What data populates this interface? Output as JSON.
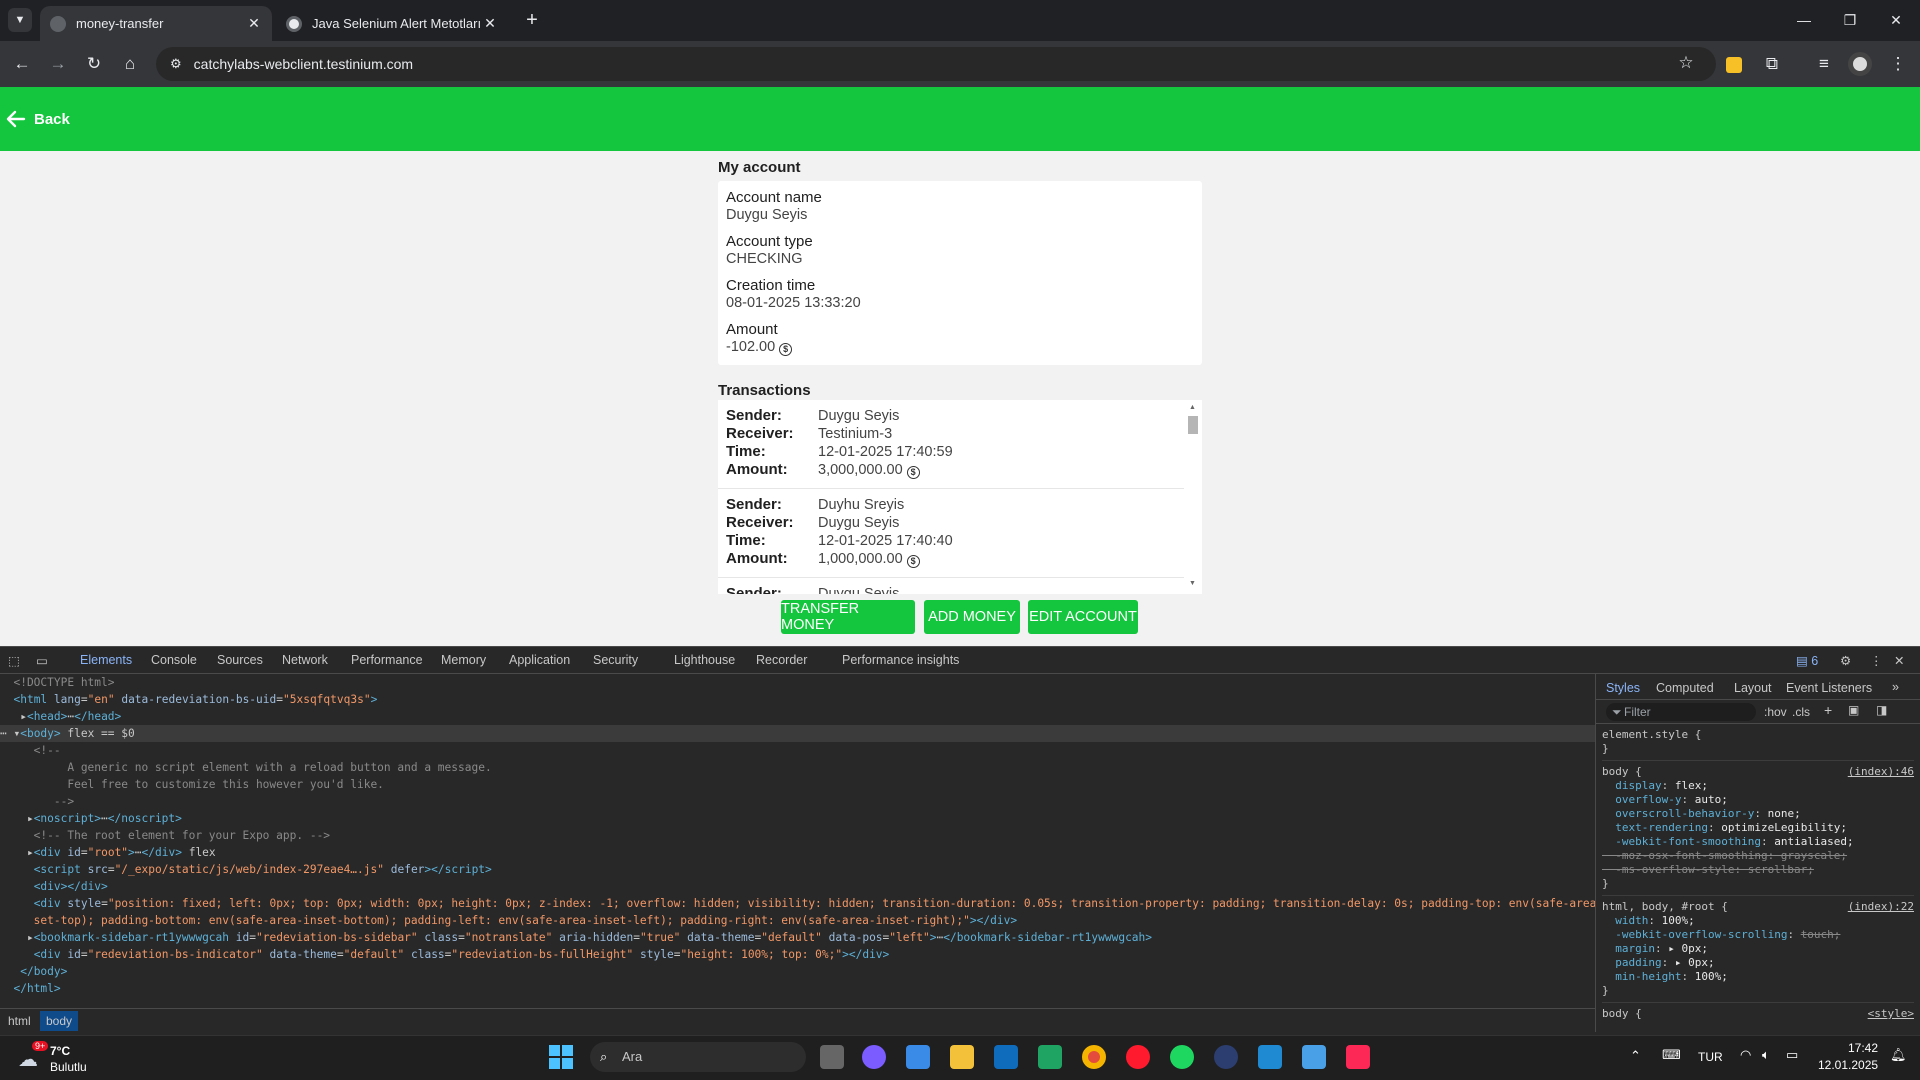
{
  "browser": {
    "tabs": [
      {
        "title": "money-transfer",
        "active": true
      },
      {
        "title": "Java Selenium Alert Metotları",
        "active": false
      }
    ],
    "url": "catchylabs-webclient.testinium.com"
  },
  "app": {
    "back_label": "Back",
    "account_section_title": "My account",
    "account": {
      "name_label": "Account name",
      "name": "Duygu Seyis",
      "type_label": "Account type",
      "type": "CHECKING",
      "creation_label": "Creation time",
      "creation": "08-01-2025 13:33:20",
      "amount_label": "Amount",
      "amount": "-102.00"
    },
    "transactions_title": "Transactions",
    "tx_labels": {
      "sender": "Sender:",
      "receiver": "Receiver:",
      "time": "Time:",
      "amount": "Amount:"
    },
    "transactions": [
      {
        "sender": "Duygu Seyis",
        "receiver": "Testinium-3",
        "time": "12-01-2025 17:40:59",
        "amount": "3,000,000.00"
      },
      {
        "sender": "Duyhu Sreyis",
        "receiver": "Duygu Seyis",
        "time": "12-01-2025 17:40:40",
        "amount": "1,000,000.00"
      },
      {
        "sender": "Duygu Seyis",
        "receiver": "",
        "time": "",
        "amount": ""
      }
    ],
    "buttons": {
      "transfer": "TRANSFER MONEY",
      "add": "ADD MONEY",
      "edit": "EDIT ACCOUNT"
    },
    "accent_color": "#13c63d"
  },
  "devtools": {
    "tabs": [
      "Elements",
      "Console",
      "Sources",
      "Network",
      "Performance",
      "Memory",
      "Application",
      "Security",
      "Lighthouse",
      "Recorder",
      "Performance insights"
    ],
    "issues_count": "6",
    "breadcrumbs": [
      "html",
      "body"
    ],
    "styles_tabs": [
      "Styles",
      "Computed",
      "Layout",
      "Event Listeners"
    ],
    "filter_placeholder": "Filter",
    "hov_label": ":hov",
    "cls_label": ".cls"
  },
  "taskbar": {
    "weather_temp": "7°C",
    "weather_desc": "Bulutlu",
    "weather_badge": "9+",
    "search_placeholder": "Ara",
    "lang": "TUR",
    "time": "17:42",
    "date": "12.01.2025"
  }
}
